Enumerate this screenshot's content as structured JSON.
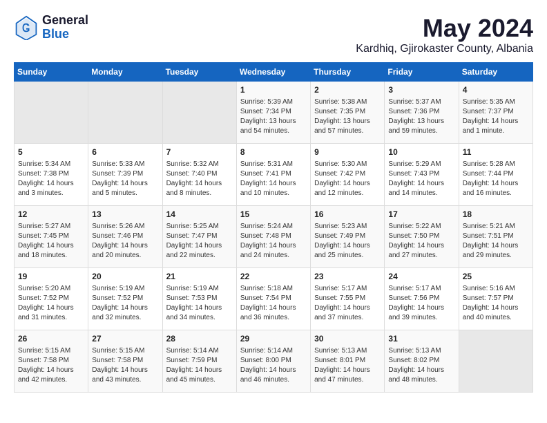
{
  "header": {
    "logo_general": "General",
    "logo_blue": "Blue",
    "main_title": "May 2024",
    "subtitle": "Kardhiq, Gjirokaster County, Albania"
  },
  "days_of_week": [
    "Sunday",
    "Monday",
    "Tuesday",
    "Wednesday",
    "Thursday",
    "Friday",
    "Saturday"
  ],
  "weeks": [
    [
      {
        "day": "",
        "info": "",
        "empty": true
      },
      {
        "day": "",
        "info": "",
        "empty": true
      },
      {
        "day": "",
        "info": "",
        "empty": true
      },
      {
        "day": "1",
        "info": "Sunrise: 5:39 AM\nSunset: 7:34 PM\nDaylight: 13 hours\nand 54 minutes.",
        "empty": false
      },
      {
        "day": "2",
        "info": "Sunrise: 5:38 AM\nSunset: 7:35 PM\nDaylight: 13 hours\nand 57 minutes.",
        "empty": false
      },
      {
        "day": "3",
        "info": "Sunrise: 5:37 AM\nSunset: 7:36 PM\nDaylight: 13 hours\nand 59 minutes.",
        "empty": false
      },
      {
        "day": "4",
        "info": "Sunrise: 5:35 AM\nSunset: 7:37 PM\nDaylight: 14 hours\nand 1 minute.",
        "empty": false
      }
    ],
    [
      {
        "day": "5",
        "info": "Sunrise: 5:34 AM\nSunset: 7:38 PM\nDaylight: 14 hours\nand 3 minutes.",
        "empty": false
      },
      {
        "day": "6",
        "info": "Sunrise: 5:33 AM\nSunset: 7:39 PM\nDaylight: 14 hours\nand 5 minutes.",
        "empty": false
      },
      {
        "day": "7",
        "info": "Sunrise: 5:32 AM\nSunset: 7:40 PM\nDaylight: 14 hours\nand 8 minutes.",
        "empty": false
      },
      {
        "day": "8",
        "info": "Sunrise: 5:31 AM\nSunset: 7:41 PM\nDaylight: 14 hours\nand 10 minutes.",
        "empty": false
      },
      {
        "day": "9",
        "info": "Sunrise: 5:30 AM\nSunset: 7:42 PM\nDaylight: 14 hours\nand 12 minutes.",
        "empty": false
      },
      {
        "day": "10",
        "info": "Sunrise: 5:29 AM\nSunset: 7:43 PM\nDaylight: 14 hours\nand 14 minutes.",
        "empty": false
      },
      {
        "day": "11",
        "info": "Sunrise: 5:28 AM\nSunset: 7:44 PM\nDaylight: 14 hours\nand 16 minutes.",
        "empty": false
      }
    ],
    [
      {
        "day": "12",
        "info": "Sunrise: 5:27 AM\nSunset: 7:45 PM\nDaylight: 14 hours\nand 18 minutes.",
        "empty": false
      },
      {
        "day": "13",
        "info": "Sunrise: 5:26 AM\nSunset: 7:46 PM\nDaylight: 14 hours\nand 20 minutes.",
        "empty": false
      },
      {
        "day": "14",
        "info": "Sunrise: 5:25 AM\nSunset: 7:47 PM\nDaylight: 14 hours\nand 22 minutes.",
        "empty": false
      },
      {
        "day": "15",
        "info": "Sunrise: 5:24 AM\nSunset: 7:48 PM\nDaylight: 14 hours\nand 24 minutes.",
        "empty": false
      },
      {
        "day": "16",
        "info": "Sunrise: 5:23 AM\nSunset: 7:49 PM\nDaylight: 14 hours\nand 25 minutes.",
        "empty": false
      },
      {
        "day": "17",
        "info": "Sunrise: 5:22 AM\nSunset: 7:50 PM\nDaylight: 14 hours\nand 27 minutes.",
        "empty": false
      },
      {
        "day": "18",
        "info": "Sunrise: 5:21 AM\nSunset: 7:51 PM\nDaylight: 14 hours\nand 29 minutes.",
        "empty": false
      }
    ],
    [
      {
        "day": "19",
        "info": "Sunrise: 5:20 AM\nSunset: 7:52 PM\nDaylight: 14 hours\nand 31 minutes.",
        "empty": false
      },
      {
        "day": "20",
        "info": "Sunrise: 5:19 AM\nSunset: 7:52 PM\nDaylight: 14 hours\nand 32 minutes.",
        "empty": false
      },
      {
        "day": "21",
        "info": "Sunrise: 5:19 AM\nSunset: 7:53 PM\nDaylight: 14 hours\nand 34 minutes.",
        "empty": false
      },
      {
        "day": "22",
        "info": "Sunrise: 5:18 AM\nSunset: 7:54 PM\nDaylight: 14 hours\nand 36 minutes.",
        "empty": false
      },
      {
        "day": "23",
        "info": "Sunrise: 5:17 AM\nSunset: 7:55 PM\nDaylight: 14 hours\nand 37 minutes.",
        "empty": false
      },
      {
        "day": "24",
        "info": "Sunrise: 5:17 AM\nSunset: 7:56 PM\nDaylight: 14 hours\nand 39 minutes.",
        "empty": false
      },
      {
        "day": "25",
        "info": "Sunrise: 5:16 AM\nSunset: 7:57 PM\nDaylight: 14 hours\nand 40 minutes.",
        "empty": false
      }
    ],
    [
      {
        "day": "26",
        "info": "Sunrise: 5:15 AM\nSunset: 7:58 PM\nDaylight: 14 hours\nand 42 minutes.",
        "empty": false
      },
      {
        "day": "27",
        "info": "Sunrise: 5:15 AM\nSunset: 7:58 PM\nDaylight: 14 hours\nand 43 minutes.",
        "empty": false
      },
      {
        "day": "28",
        "info": "Sunrise: 5:14 AM\nSunset: 7:59 PM\nDaylight: 14 hours\nand 45 minutes.",
        "empty": false
      },
      {
        "day": "29",
        "info": "Sunrise: 5:14 AM\nSunset: 8:00 PM\nDaylight: 14 hours\nand 46 minutes.",
        "empty": false
      },
      {
        "day": "30",
        "info": "Sunrise: 5:13 AM\nSunset: 8:01 PM\nDaylight: 14 hours\nand 47 minutes.",
        "empty": false
      },
      {
        "day": "31",
        "info": "Sunrise: 5:13 AM\nSunset: 8:02 PM\nDaylight: 14 hours\nand 48 minutes.",
        "empty": false
      },
      {
        "day": "",
        "info": "",
        "empty": true
      }
    ]
  ]
}
